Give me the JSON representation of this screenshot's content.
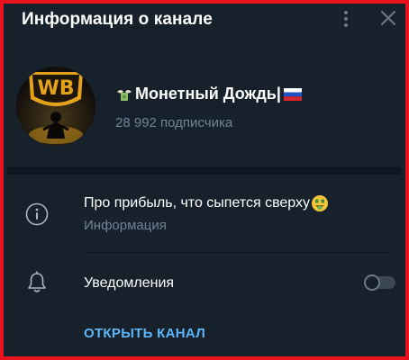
{
  "header": {
    "title": "Информация о канале",
    "menu_icon": "more-vertical-icon",
    "close_icon": "close-icon"
  },
  "channel": {
    "avatar_logo_text": "WB",
    "name": "Монетный Дождь|",
    "name_prefix_icon": "money-with-wings-icon",
    "name_suffix_icon": "russia-flag-icon",
    "subscribers": "28 992 подписчика"
  },
  "about": {
    "icon": "info-icon",
    "text": "Про прибыль, что сыпется сверху",
    "text_suffix_icon": "money-mouth-face-icon",
    "label": "Информация"
  },
  "notifications": {
    "icon": "bell-icon",
    "label": "Уведомления",
    "enabled": false
  },
  "actions": {
    "open_channel": "ОТКРЫТЬ КАНАЛ"
  },
  "colors": {
    "background": "#17212b",
    "frame_border": "#e8121c",
    "accent": "#5eb5f7",
    "secondary_text": "#708499"
  }
}
